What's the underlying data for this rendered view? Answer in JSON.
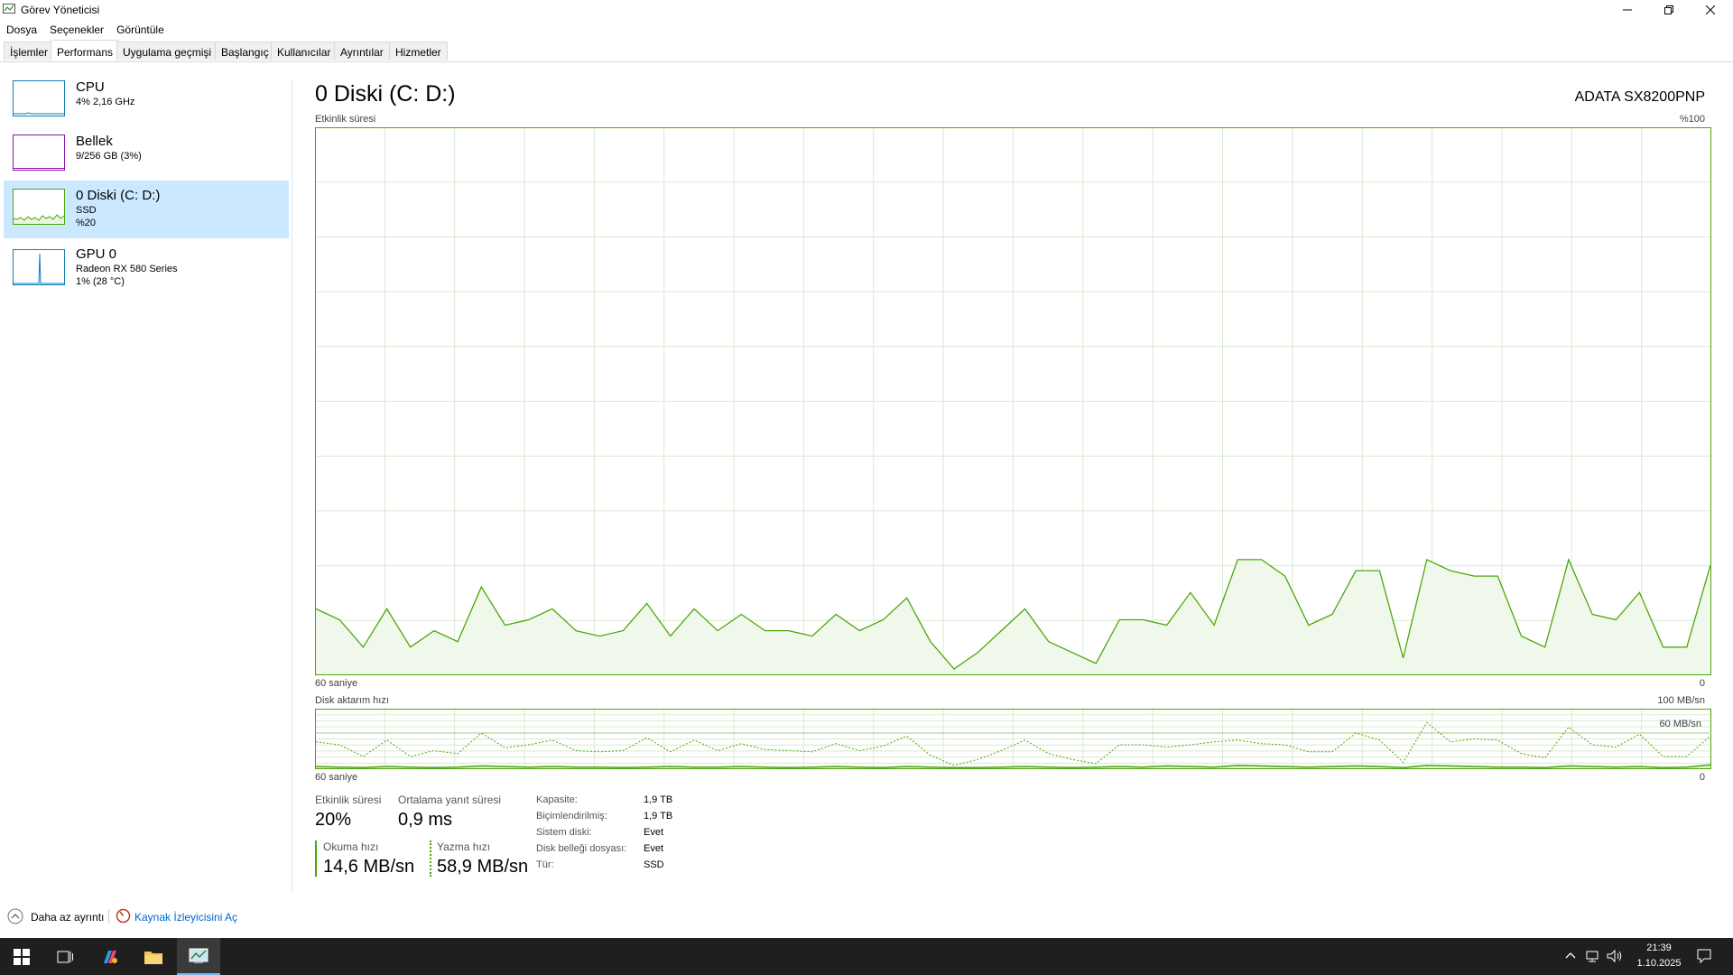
{
  "window": {
    "title": "Görev Yöneticisi"
  },
  "menu": [
    "Dosya",
    "Seçenekler",
    "Görüntüle"
  ],
  "tabs": [
    "İşlemler",
    "Performans",
    "Uygulama geçmişi",
    "Başlangıç",
    "Kullanıcılar",
    "Ayrıntılar",
    "Hizmetler"
  ],
  "active_tab": "Performans",
  "sidebar": {
    "cpu": {
      "title": "CPU",
      "sub": "4% 2,16 GHz"
    },
    "memory": {
      "title": "Bellek",
      "sub": "9/256 GB (3%)"
    },
    "disk": {
      "title": "0 Diski (C: D:)",
      "sub1": "SSD",
      "sub2": "%20"
    },
    "gpu": {
      "title": "GPU 0",
      "sub1": "Radeon RX 580 Series",
      "sub2": "1% (28 °C)"
    }
  },
  "main": {
    "title": "0 Diski (C: D:)",
    "device": "ADATA SX8200PNP",
    "activity_label": "Etkinlik süresi",
    "activity_max": "%100",
    "time_left": "60 saniye",
    "time_right": "0",
    "transfer_label": "Disk aktarım hızı",
    "transfer_max": "100 MB/sn",
    "transfer_mid": "60 MB/sn"
  },
  "stats": {
    "active_time_label": "Etkinlik süresi",
    "active_time": "20%",
    "avg_response_label": "Ortalama yanıt süresi",
    "avg_response": "0,9 ms",
    "read_label": "Okuma hızı",
    "read": "14,6 MB/sn",
    "write_label": "Yazma hızı",
    "write": "58,9 MB/sn"
  },
  "props": [
    {
      "key": "Kapasite:",
      "val": "1,9 TB"
    },
    {
      "key": "Biçimlendirilmiş:",
      "val": "1,9 TB"
    },
    {
      "key": "Sistem diski:",
      "val": "Evet"
    },
    {
      "key": "Disk belleği dosyası:",
      "val": "Evet"
    },
    {
      "key": "Tür:",
      "val": "SSD"
    }
  ],
  "footer": {
    "fewer": "Daha az ayrıntı",
    "resmon": "Kaynak İzleyicisini Aç"
  },
  "taskbar": {
    "time": "21:39",
    "date": "1.10.2025"
  },
  "colors": {
    "disk": "#4da60c",
    "cpu": "#117dbb",
    "memory": "#8b12ae",
    "selected": "#cce8ff",
    "link": "#0066cc"
  },
  "chart_data": [
    {
      "type": "area",
      "x": [
        60,
        59,
        58,
        57,
        56,
        55,
        54,
        53,
        52,
        51,
        50,
        49,
        48,
        47,
        46,
        45,
        44,
        43,
        42,
        41,
        40,
        39,
        38,
        37,
        36,
        35,
        34,
        33,
        32,
        31,
        30,
        29,
        28,
        27,
        26,
        25,
        24,
        23,
        22,
        21,
        20,
        19,
        18,
        17,
        16,
        15,
        14,
        13,
        12,
        11,
        10,
        9,
        8,
        7,
        6,
        5,
        4,
        3,
        2,
        1,
        0
      ],
      "values": [
        12,
        10,
        5,
        12,
        5,
        8,
        6,
        16,
        9,
        10,
        12,
        8,
        7,
        8,
        13,
        7,
        12,
        8,
        11,
        8,
        8,
        7,
        11,
        8,
        10,
        14,
        6,
        1,
        4,
        8,
        12,
        6,
        4,
        2,
        10,
        10,
        9,
        15,
        9,
        21,
        21,
        18,
        9,
        11,
        19,
        19,
        3,
        21,
        19,
        18,
        18,
        7,
        5,
        21,
        11,
        10,
        15,
        5,
        5,
        20
      ],
      "xlabel": "60 saniye",
      "ylim": [
        0,
        100
      ]
    },
    {
      "type": "line",
      "x": [
        60,
        59,
        58,
        57,
        56,
        55,
        54,
        53,
        52,
        51,
        50,
        49,
        48,
        47,
        46,
        45,
        44,
        43,
        42,
        41,
        40,
        39,
        38,
        37,
        36,
        35,
        34,
        33,
        32,
        31,
        30,
        29,
        28,
        27,
        26,
        25,
        24,
        23,
        22,
        21,
        20,
        19,
        18,
        17,
        16,
        15,
        14,
        13,
        12,
        11,
        10,
        9,
        8,
        7,
        6,
        5,
        4,
        3,
        2,
        1,
        0
      ],
      "series": [
        {
          "name": "Okuma hızı",
          "values": [
            3,
            2,
            1,
            3,
            2,
            1,
            2,
            4,
            3,
            2,
            3,
            2,
            2,
            1,
            2,
            3,
            2,
            2,
            3,
            2,
            1,
            2,
            3,
            2,
            1,
            3,
            2,
            1,
            1,
            2,
            3,
            2,
            1,
            2,
            3,
            2,
            4,
            3,
            2,
            5,
            4,
            3,
            2,
            3,
            4,
            3,
            1,
            5,
            4,
            3,
            2,
            2,
            1,
            4,
            3,
            2,
            3,
            1,
            2,
            6
          ]
        },
        {
          "name": "Yazma hızı",
          "values": [
            45,
            40,
            20,
            48,
            20,
            30,
            25,
            60,
            35,
            40,
            48,
            30,
            28,
            30,
            52,
            28,
            48,
            30,
            42,
            32,
            30,
            28,
            42,
            30,
            38,
            55,
            22,
            5,
            15,
            30,
            48,
            25,
            15,
            8,
            40,
            40,
            36,
            40,
            45,
            48,
            42,
            40,
            28,
            28,
            60,
            48,
            10,
            78,
            45,
            50,
            48,
            25,
            18,
            70,
            40,
            36,
            58,
            20,
            20,
            55
          ]
        }
      ],
      "xlabel": "60 saniye",
      "ylim": [
        0,
        100
      ]
    }
  ]
}
